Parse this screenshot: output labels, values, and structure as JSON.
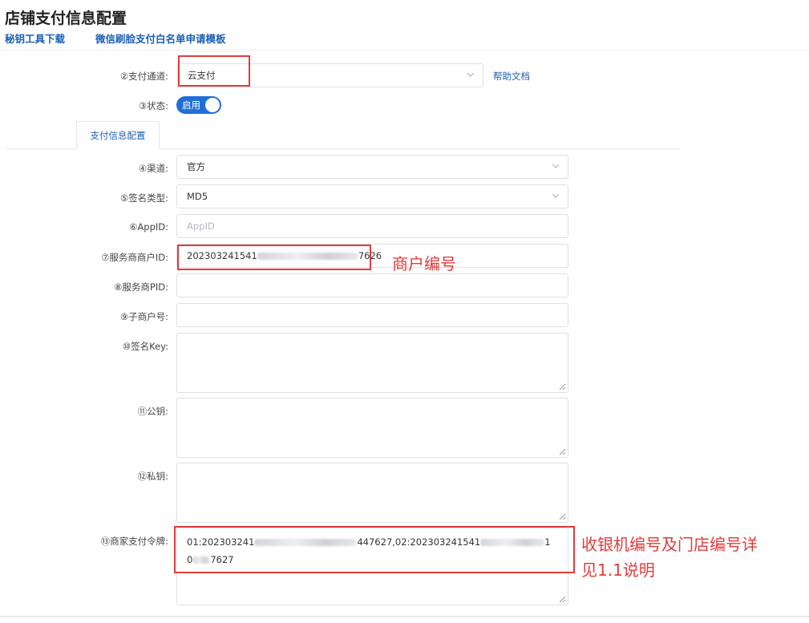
{
  "page": {
    "title": "店铺支付信息配置",
    "links": [
      "秘钥工具下载",
      "微信刷脸支付白名单申请模板"
    ]
  },
  "form": {
    "payment_channel": {
      "label": "②支付通道:",
      "value": "云支付",
      "help_link": "帮助文档"
    },
    "status": {
      "label": "③状态:",
      "toggle_text": "启用",
      "enabled": true
    },
    "tab": "支付信息配置",
    "channel": {
      "label": "④渠道:",
      "value": "官方"
    },
    "sign_type": {
      "label": "⑤签名类型:",
      "value": "MD5"
    },
    "app_id": {
      "label": "⑥AppID:",
      "placeholder": "AppID",
      "value": ""
    },
    "service_merchant_id": {
      "label": "⑦服务商商户ID:",
      "value_prefix": "202303241541",
      "value_suffix": "7626"
    },
    "service_pid": {
      "label": "⑧服务商PID:",
      "value": ""
    },
    "sub_merchant_no": {
      "label": "⑨子商户号:",
      "value": ""
    },
    "sign_key": {
      "label": "⑩签名Key:",
      "value": ""
    },
    "public_key": {
      "label": "⑪公钥:",
      "value": ""
    },
    "private_key": {
      "label": "⑫私钥:",
      "value": ""
    },
    "merchant_token": {
      "label": "⑬商家支付令牌:",
      "line1_a": "01:202303241",
      "line1_b": "447627,02:202303241541",
      "line1_c": "1",
      "line2_a": "0",
      "line2_b": "7627"
    }
  },
  "annotations": {
    "merchant_no": "商户编号",
    "cashier_line1": "收银机编号及门店编号详",
    "cashier_line2": "见1.1说明"
  },
  "colors": {
    "accent": "#1f6fd6",
    "link": "#1a5fb4",
    "annotation_red": "#e23b3b",
    "border": "#dcdfe6"
  }
}
